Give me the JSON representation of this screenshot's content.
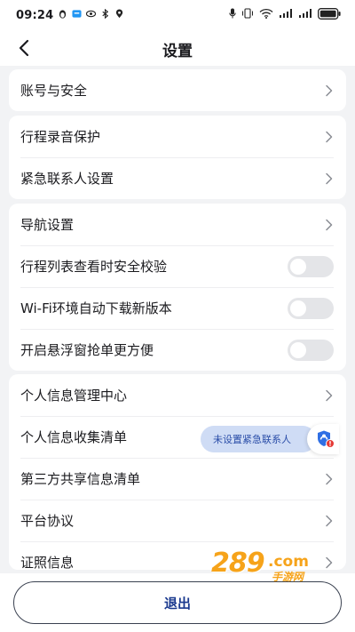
{
  "status_bar": {
    "time": "09:24"
  },
  "header": {
    "title": "设置"
  },
  "groups": [
    {
      "items": [
        {
          "label": "账号与安全",
          "control": "chevron"
        }
      ]
    },
    {
      "items": [
        {
          "label": "行程录音保护",
          "control": "chevron"
        },
        {
          "label": "紧急联系人设置",
          "control": "chevron"
        }
      ]
    },
    {
      "items": [
        {
          "label": "导航设置",
          "control": "chevron"
        },
        {
          "label": "行程列表查看时安全校验",
          "control": "toggle",
          "on": false
        },
        {
          "label": "Wi-Fi环境自动下载新版本",
          "control": "toggle",
          "on": false
        },
        {
          "label": "开启悬浮窗抢单更方便",
          "control": "toggle",
          "on": false
        }
      ]
    },
    {
      "items": [
        {
          "label": "个人信息管理中心",
          "control": "chevron"
        },
        {
          "label": "个人信息收集清单",
          "control": "chevron"
        },
        {
          "label": "第三方共享信息清单",
          "control": "chevron"
        },
        {
          "label": "平台协议",
          "control": "chevron"
        },
        {
          "label": "证照信息",
          "control": "chevron"
        }
      ]
    }
  ],
  "floating_tip": {
    "text": "未设置紧急联系人",
    "badge_icon": "shield-alert-icon"
  },
  "footer": {
    "logout_label": "退出"
  },
  "watermark": {
    "number": "289",
    "suffix": ".com",
    "cn": "手游网"
  },
  "colors": {
    "accent": "#1b3a8f",
    "tip_bg": "#cfdcf5",
    "badge_blue": "#2f6fe4",
    "badge_red": "#e53935",
    "watermark": "#f6a31a"
  }
}
